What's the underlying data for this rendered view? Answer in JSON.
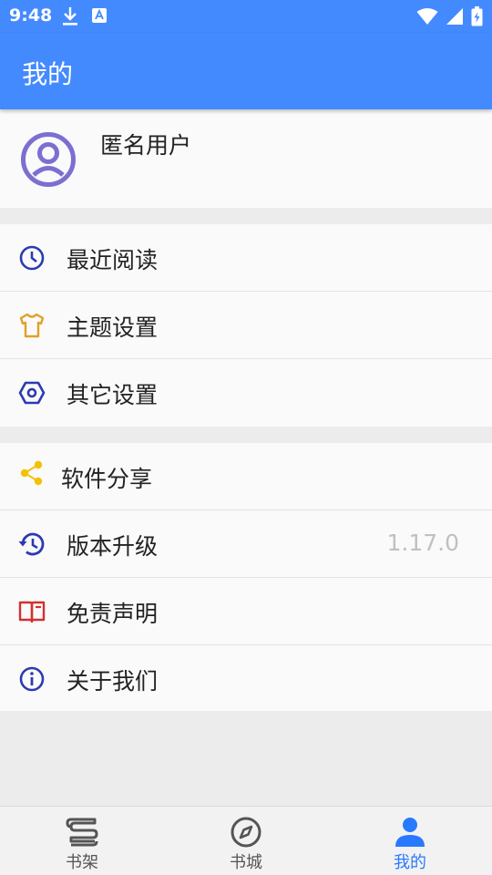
{
  "status_bar": {
    "time": "9:48",
    "left_icons": [
      "download-icon",
      "keyboard-a-icon"
    ],
    "right_icons": [
      "wifi-icon",
      "signal-icon",
      "battery-charging-icon"
    ]
  },
  "app_bar": {
    "title": "我的"
  },
  "profile": {
    "avatar_icon": "account-circle-icon",
    "name": "匿名用户"
  },
  "menu_groups": [
    {
      "items": [
        {
          "label": "最近阅读",
          "icon": "clock-icon",
          "icon_color": "#2c3ab3"
        },
        {
          "label": "主题设置",
          "icon": "tshirt-icon",
          "icon_color": "#e0a02a"
        },
        {
          "label": "其它设置",
          "icon": "hexagon-settings-icon",
          "icon_color": "#2c3ab3"
        }
      ]
    },
    {
      "items": [
        {
          "label": "软件分享",
          "icon": "share-icon",
          "icon_color": "#f2c200"
        },
        {
          "label": "版本升级",
          "icon": "history-icon",
          "icon_color": "#2c3ab3",
          "value": "1.17.0"
        },
        {
          "label": "免责声明",
          "icon": "book-open-icon",
          "icon_color": "#d32f2f"
        },
        {
          "label": "关于我们",
          "icon": "info-icon",
          "icon_color": "#2c3ab3"
        }
      ]
    }
  ],
  "bottom_nav": {
    "items": [
      {
        "label": "书架",
        "icon": "bookshelf-icon",
        "active": false
      },
      {
        "label": "书城",
        "icon": "compass-icon",
        "active": false
      },
      {
        "label": "我的",
        "icon": "person-icon",
        "active": true
      }
    ]
  },
  "colors": {
    "primary": "#448aff",
    "active_tab": "#2979ff",
    "avatar": "#7b6fd1"
  }
}
